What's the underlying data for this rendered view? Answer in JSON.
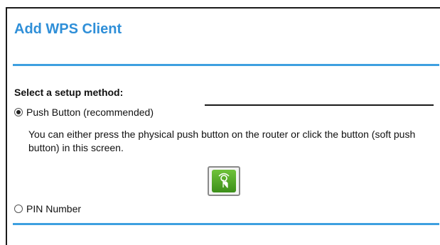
{
  "page": {
    "title": "Add WPS Client"
  },
  "setup": {
    "label": "Select a setup method:",
    "options": [
      {
        "label": "Push Button (recommended)",
        "selected": true
      },
      {
        "label": "PIN Number",
        "selected": false
      }
    ],
    "push_button_description": "You can either press the physical push button on the router or click the button (soft push button) in this screen."
  },
  "colors": {
    "title": "#2f8fd8",
    "divider": "#3ea0e0",
    "wps_button": "#4fa62a"
  },
  "icons": {
    "wps_button": "wps-push-hand-icon"
  }
}
